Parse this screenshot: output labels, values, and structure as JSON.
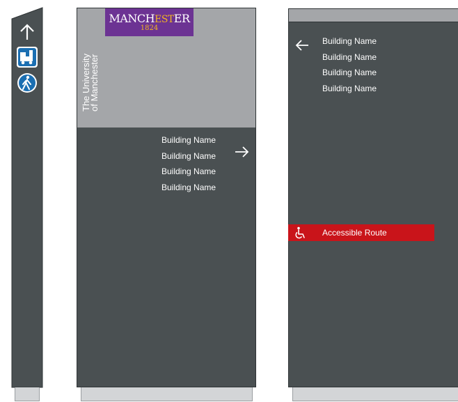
{
  "university_logo": {
    "wordmark_before": "MANCH",
    "wordmark_highlight": "EST",
    "wordmark_after": "ER",
    "year": "1824",
    "brand_color": "#6c3393",
    "accent_color": "#f0b323"
  },
  "university_name": {
    "line1": "The University",
    "line2": "of Manchester"
  },
  "totem_icons": [
    "up-arrow-icon",
    "vehicle-access-icon",
    "pedestrian-icon"
  ],
  "sign_center": {
    "destinations": [
      "Building Name",
      "Building Name",
      "Building Name",
      "Building Name"
    ],
    "arrow": "→"
  },
  "sign_right": {
    "destinations": [
      "Building Name",
      "Building Name",
      "Building Name",
      "Building Name"
    ],
    "arrow": "←",
    "accessible_route": {
      "icon": "wheelchair-icon",
      "label": "Accessible Route",
      "color": "#c9141a"
    }
  },
  "colors": {
    "panel": "#4a5052",
    "header_grey": "#a4a6a9",
    "icon_blue": "#1b6fb2"
  }
}
